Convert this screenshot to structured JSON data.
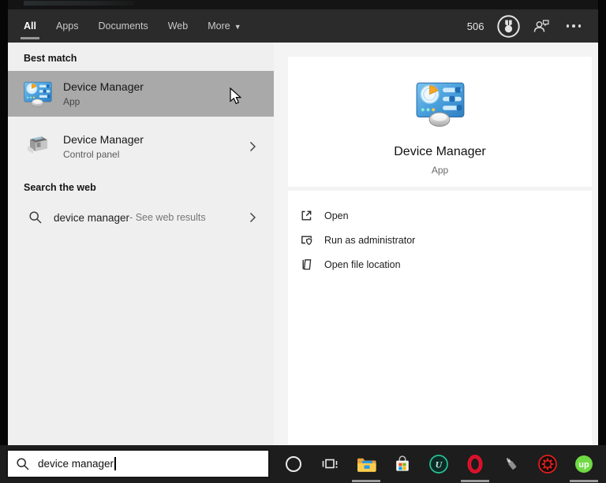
{
  "tabs_bar": {
    "tabs": [
      {
        "label": "All",
        "selected": true
      },
      {
        "label": "Apps",
        "selected": false
      },
      {
        "label": "Documents",
        "selected": false
      },
      {
        "label": "Web",
        "selected": false
      },
      {
        "label": "More",
        "selected": false,
        "has_dropdown": true
      }
    ],
    "rewards_points": "506",
    "icons": {
      "rewards": "rewards-medal-icon",
      "feedback": "feedback-person-icon",
      "more_options": "ellipsis-icon"
    }
  },
  "left_panel": {
    "best_match": {
      "header": "Best match",
      "item": {
        "title": "Device Manager",
        "subtitle": "App",
        "icon": "device-manager-icon",
        "highlighted": true
      }
    },
    "secondary_item": {
      "title": "Device Manager",
      "subtitle": "Control panel",
      "icon": "control-panel-device-icon",
      "has_chevron": true
    },
    "web_section": {
      "header": "Search the web",
      "item": {
        "query": "device manager",
        "suffix": " - See web results",
        "icon": "search-icon",
        "has_chevron": true
      }
    }
  },
  "preview_panel": {
    "app_title": "Device Manager",
    "app_type": "App",
    "app_icon": "device-manager-icon",
    "actions": [
      {
        "label": "Open",
        "icon": "open-window-icon"
      },
      {
        "label": "Run as administrator",
        "icon": "admin-shield-icon"
      },
      {
        "label": "Open file location",
        "icon": "file-location-icon"
      }
    ]
  },
  "search_bar": {
    "value": "device manager",
    "icon": "search-icon"
  },
  "taskbar": {
    "buttons": [
      {
        "name": "cortana",
        "icon": "cortana-circle-icon",
        "running": false
      },
      {
        "name": "task-view",
        "icon": "task-view-icon",
        "running": false
      },
      {
        "name": "file-explorer",
        "icon": "file-explorer-icon",
        "running": true
      },
      {
        "name": "microsoft-store",
        "icon": "microsoft-store-icon",
        "running": false
      },
      {
        "name": "iobit-uninstaller",
        "icon": "iobit-u-icon",
        "letter": "U",
        "running": false
      },
      {
        "name": "opera",
        "icon": "opera-o-icon",
        "running": true
      },
      {
        "name": "usb-device",
        "icon": "usb-cable-icon",
        "running": false
      },
      {
        "name": "driver-booster",
        "icon": "driver-booster-gear-icon",
        "running": false
      },
      {
        "name": "upwork",
        "icon": "upwork-icon",
        "label": "up",
        "running": true
      }
    ]
  },
  "colors": {
    "topbar_bg": "#2b2b2b",
    "left_panel_bg": "#efefef",
    "highlight_bg": "#a9a9a9",
    "right_panel_bg": "#f4f4f4",
    "card_bg": "#ffffff",
    "taskbar_bg": "#1d1d1d",
    "dm_icon_blue": "#3e9be0",
    "dm_icon_orange": "#f5a623",
    "opera_red": "#e8112d",
    "upwork_green": "#6fda44",
    "store_squares": [
      "#f25022",
      "#7fba00",
      "#00a4ef",
      "#ffb900"
    ]
  }
}
